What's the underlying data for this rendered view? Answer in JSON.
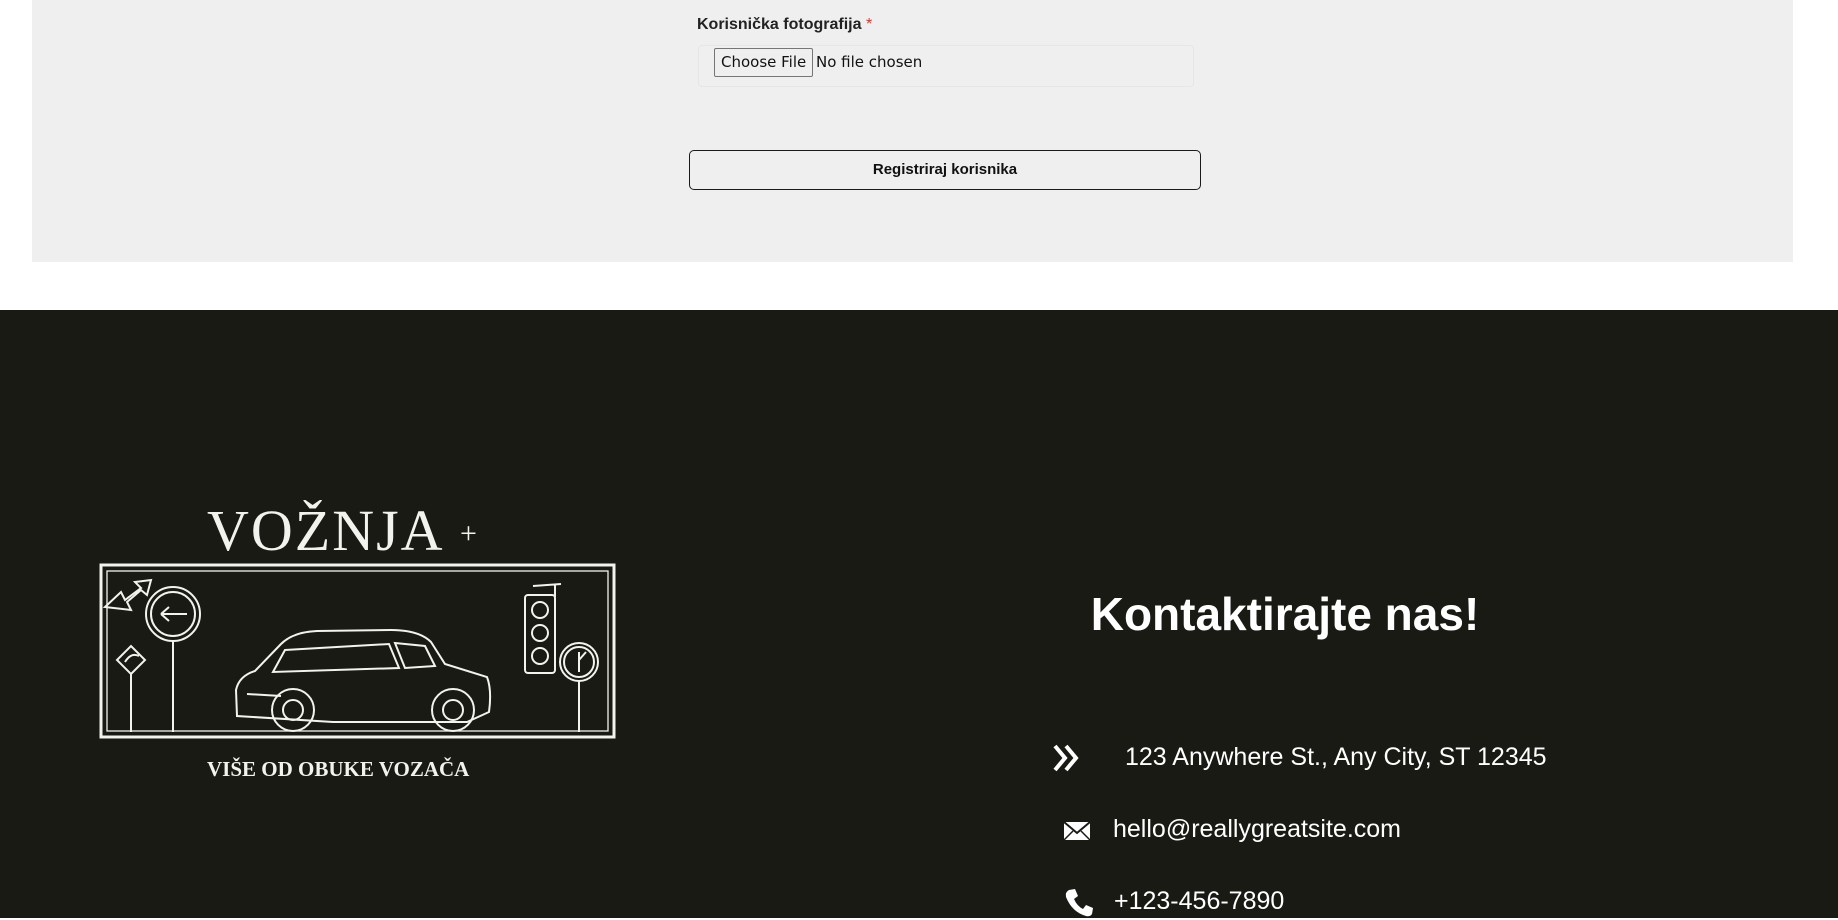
{
  "form": {
    "photo_label": "Korisnička fotografija",
    "required_mark": "*",
    "file_input": {
      "button_label": "Choose File",
      "status": "No file chosen"
    },
    "submit_label": "Registriraj korisnika"
  },
  "footer": {
    "logo": {
      "title": "VOŽNJA",
      "plus": "+",
      "tagline": "VIŠE OD OBUKE VOZAČA"
    },
    "contact": {
      "title": "Kontaktirajte nas!",
      "address": "123 Anywhere St., Any City, ST 12345",
      "address_icon": "double-chevron-right-icon",
      "email": "hello@reallygreatsite.com",
      "email_icon": "envelope-icon",
      "phone": "+123-456-7890",
      "phone_icon": "phone-icon"
    }
  },
  "colors": {
    "form_background": "#efefef",
    "footer_background": "#191a14",
    "required": "#d9342b",
    "footer_text": "#ffffff"
  }
}
